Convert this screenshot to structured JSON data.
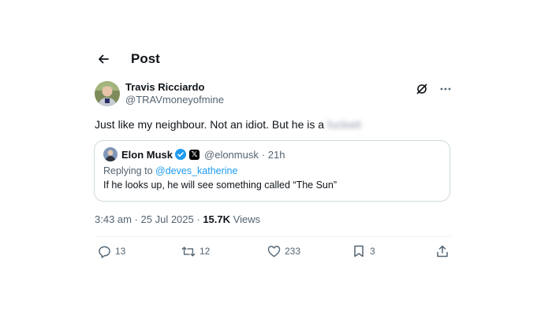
{
  "header": {
    "title": "Post"
  },
  "post": {
    "author_name": "Travis Ricciardo",
    "author_handle": "@TRAVmoneyofmine",
    "text": "Just like my neighbour. Not an idiot. But he is a",
    "hidden_text": "fuckwit",
    "quote": {
      "author_name": "Elon Musk",
      "author_handle": "@elonmusk",
      "age": "· 21h",
      "replying_prefix": "Replying to",
      "replying_to": "@deves_katherine",
      "text": "If he looks up, he will see something called “The Sun”"
    },
    "timestamp": "3:43 am · 25 Jul 2025 ·",
    "views_count": "15.7K",
    "views_label": "Views",
    "stats": {
      "replies": "13",
      "reposts": "12",
      "likes": "233",
      "bookmarks": "3"
    }
  },
  "colors": {
    "accent": "#1d9bf0",
    "muted": "#536471",
    "text": "#0f1419",
    "border": "#cfd9de"
  },
  "icons": [
    "back-arrow-icon",
    "grok-icon",
    "more-icon",
    "verified-icon",
    "x-badge-icon",
    "reply-icon",
    "repost-icon",
    "like-icon",
    "bookmark-icon",
    "share-icon"
  ]
}
